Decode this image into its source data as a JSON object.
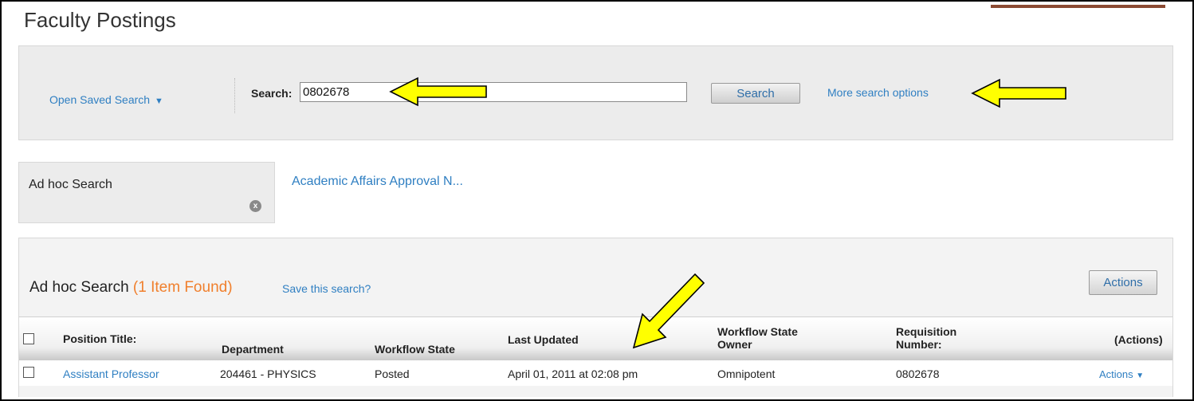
{
  "page": {
    "title": "Faculty Postings"
  },
  "search_panel": {
    "saved_search_label": "Open Saved Search",
    "saved_search_caret": "▼",
    "search_label": "Search:",
    "search_value": "0802678",
    "search_button": "Search",
    "more_options": "More search options"
  },
  "tabs": {
    "active_tab": "Ad hoc Search",
    "close_glyph": "x",
    "other_tab": "Academic Affairs Approval N..."
  },
  "results": {
    "heading": "Ad hoc Search",
    "count_text": "(1 Item Found)",
    "save_search": "Save this search?",
    "actions_button": "Actions",
    "columns": {
      "position_title": "Position Title:",
      "department": "Department",
      "workflow_state": "Workflow State",
      "last_updated": "Last Updated",
      "workflow_state_owner_line1": "Workflow State",
      "workflow_state_owner_line2": "Owner",
      "requisition_line1": "Requisition",
      "requisition_line2": "Number:",
      "actions": "(Actions)"
    },
    "rows": [
      {
        "position_title": "Assistant Professor",
        "department": "204461 - PHYSICS",
        "workflow_state": "Posted",
        "last_updated": "April 01, 2011 at 02:08 pm",
        "owner": "Omnipotent",
        "requisition": "0802678",
        "actions": "Actions",
        "actions_caret": "▼"
      }
    ]
  },
  "colors": {
    "link": "#2f7fc2",
    "count_accent": "#f07f2c",
    "annotation_arrow_fill": "#ffff00",
    "annotation_arrow_stroke": "#000000"
  }
}
